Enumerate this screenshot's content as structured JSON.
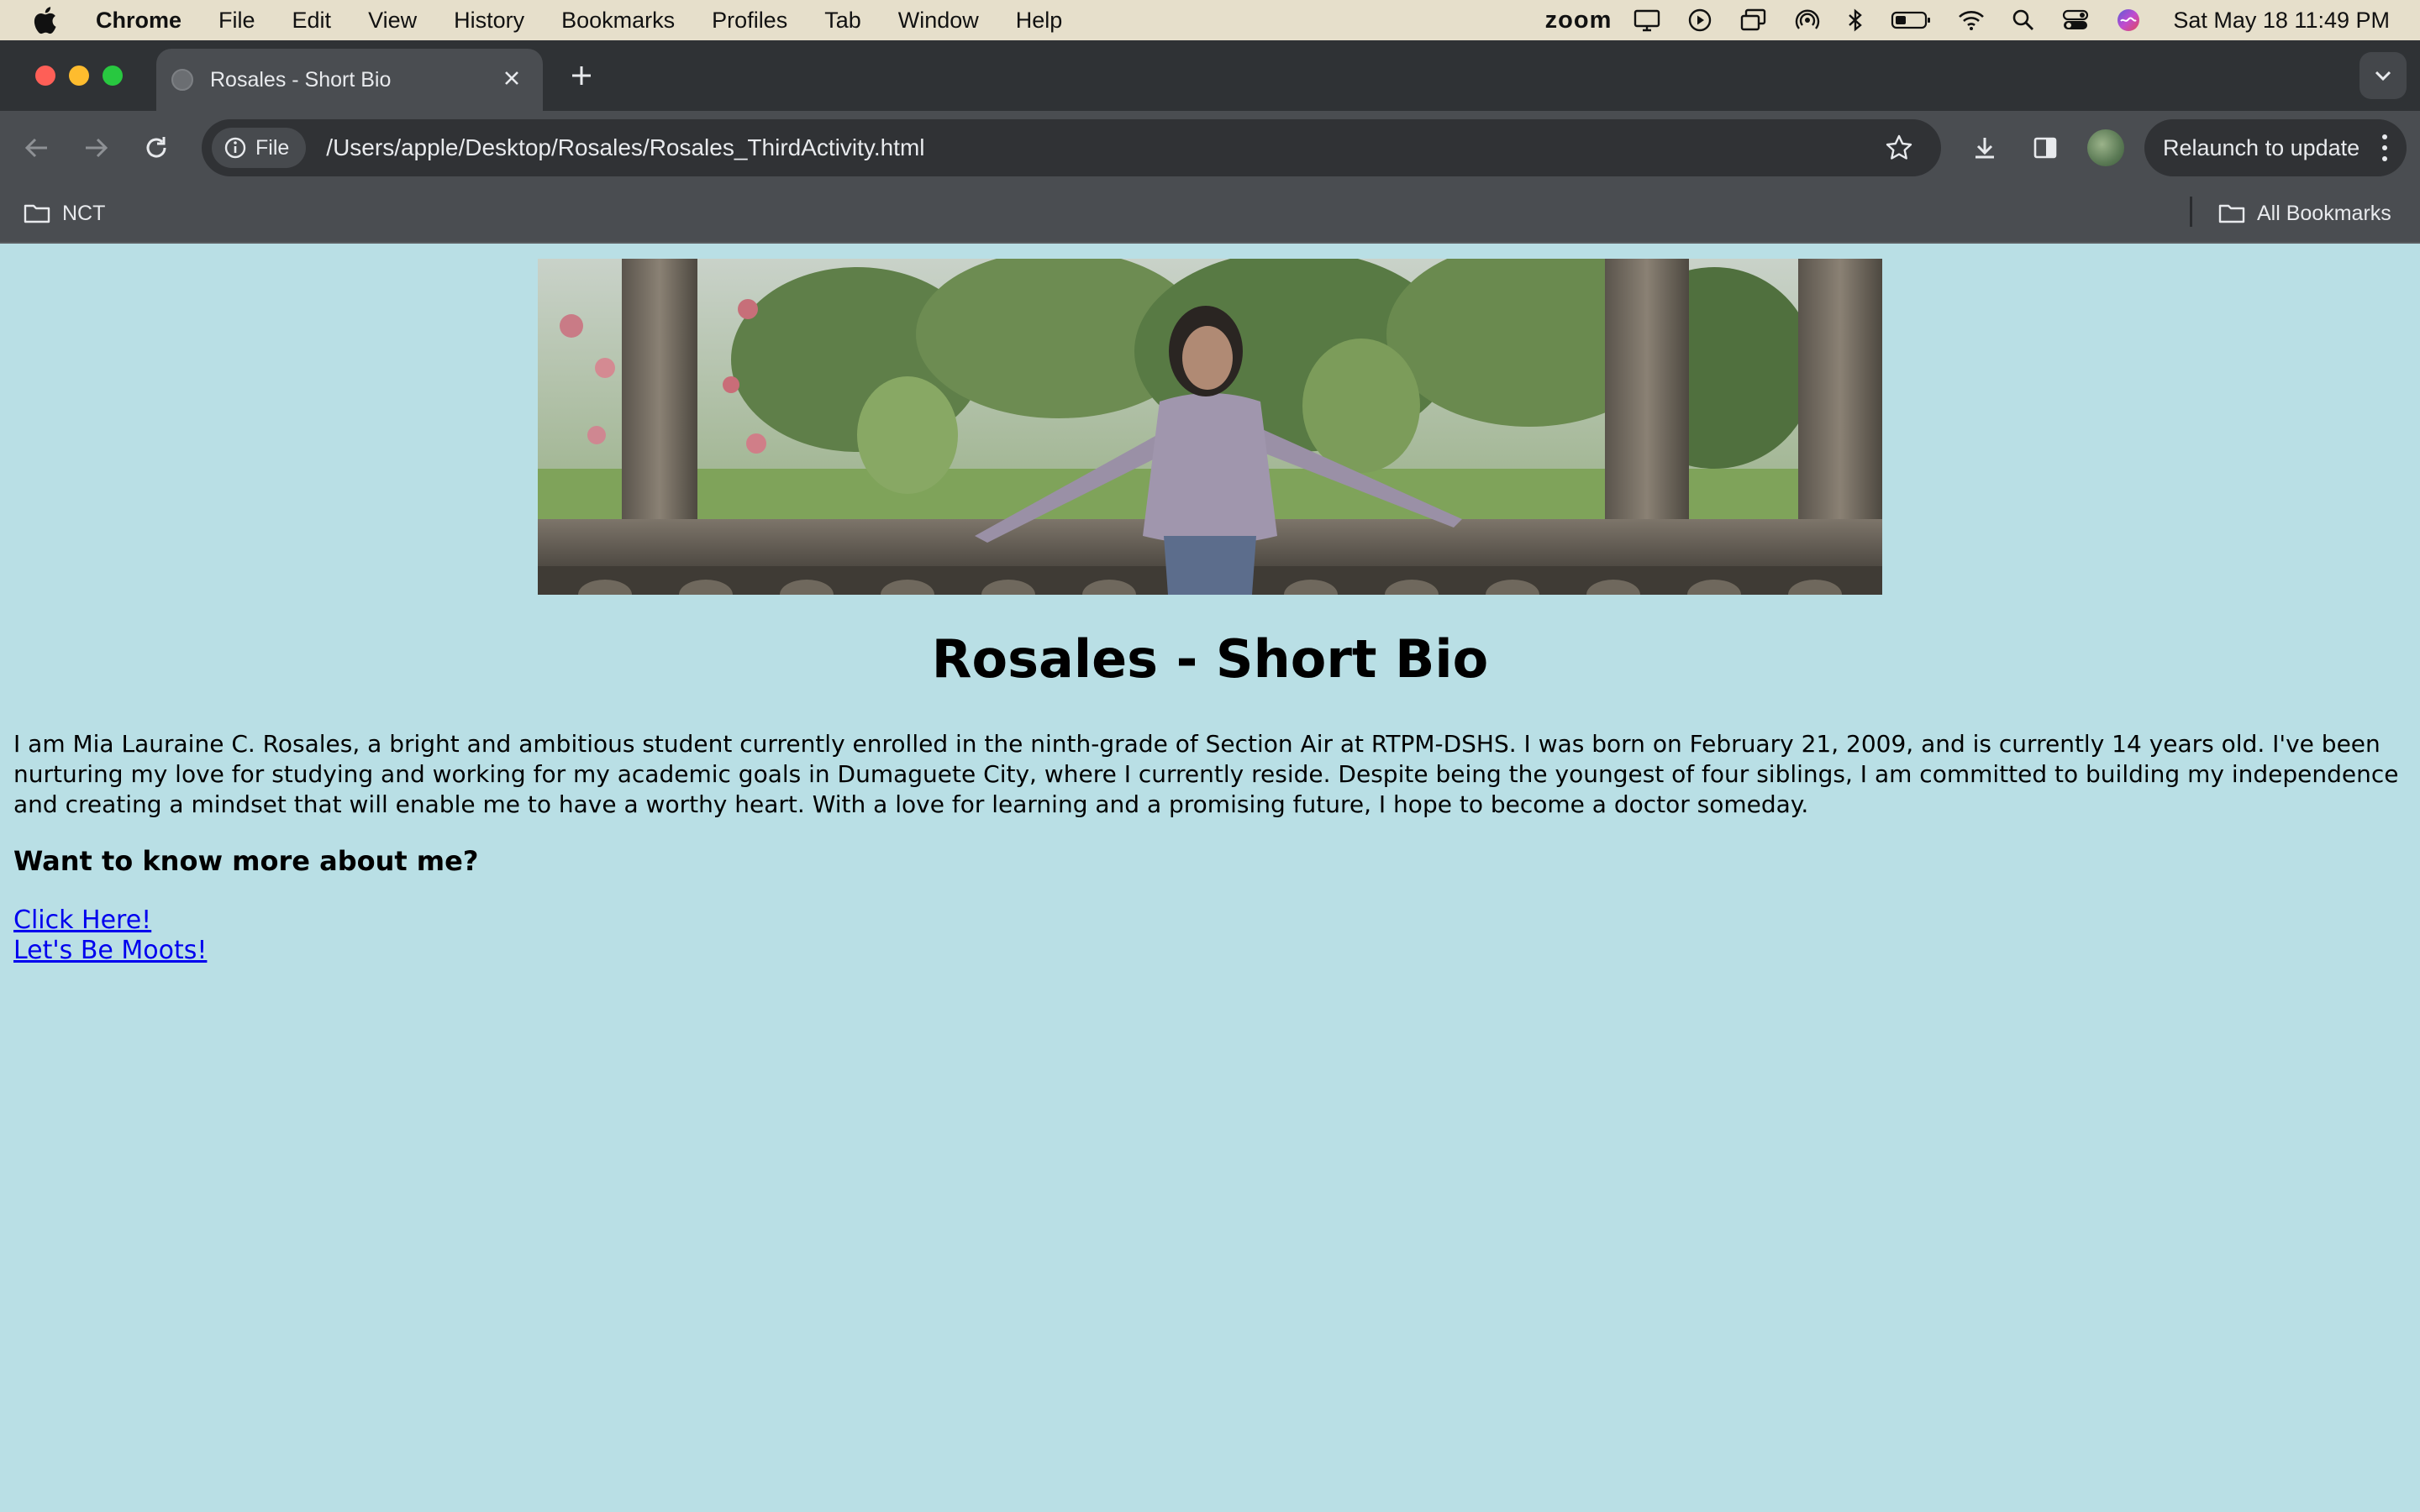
{
  "menubar": {
    "app_name": "Chrome",
    "items": [
      "File",
      "Edit",
      "View",
      "History",
      "Bookmarks",
      "Profiles",
      "Tab",
      "Window",
      "Help"
    ],
    "zoom_label": "zoom",
    "clock": "Sat May 18  11:49 PM"
  },
  "browser": {
    "tab_title": "Rosales - Short Bio",
    "chip_label": "File",
    "url": "/Users/apple/Desktop/Rosales/Rosales_ThirdActivity.html",
    "relaunch_label": "Relaunch to update",
    "bookmarks": {
      "folder": "NCT",
      "all": "All Bookmarks"
    }
  },
  "page": {
    "title": "Rosales - Short Bio",
    "bio": "I am Mia Lauraine C. Rosales, a bright and ambitious student currently enrolled in the ninth-grade of Section Air at RTPM-DSHS. I was born on February 21, 2009, and is currently 14 years old. I've been nurturing my love for studying and working for my academic goals in Dumaguete City, where I currently reside. Despite being the youngest of four siblings, I am committed to building my independence and creating a mindset that will enable me to have a worthy heart. With a love for learning and a promising future, I hope to become a doctor someday.",
    "subheading": "Want to know more about me?",
    "links": [
      "Click Here!",
      "Let's Be Moots!"
    ]
  },
  "colors": {
    "page_bg": "#b9dfe5",
    "link": "#0000ee",
    "chrome_dark": "#2f3235",
    "chrome_toolbar": "#4a4d51"
  }
}
